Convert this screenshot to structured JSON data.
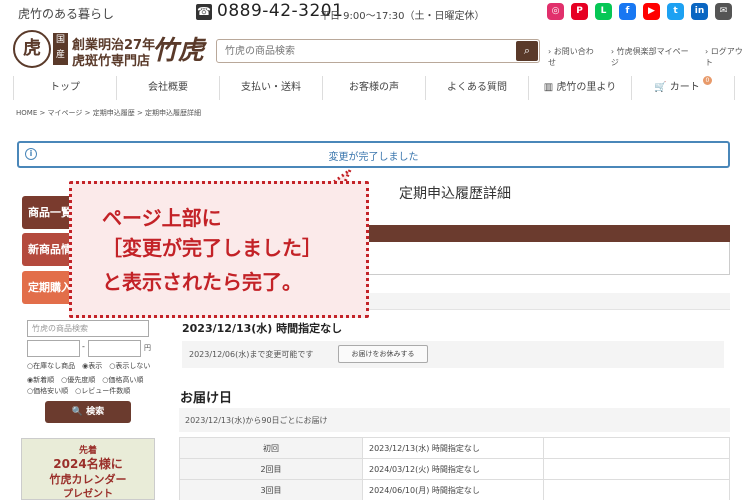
{
  "topbar": {
    "tagline": "虎竹のある暮らし",
    "phone": "0889-42-3201",
    "hours": "平日 9:00～17:30（土・日曜定休）",
    "social": [
      {
        "name": "instagram-icon",
        "color": "#e1306c",
        "glyph": "◎"
      },
      {
        "name": "pinterest-icon",
        "color": "#e60023",
        "glyph": "P"
      },
      {
        "name": "line-icon",
        "color": "#06c755",
        "glyph": "L"
      },
      {
        "name": "facebook-icon",
        "color": "#1877f2",
        "glyph": "f"
      },
      {
        "name": "youtube-icon",
        "color": "#ff0000",
        "glyph": "▶"
      },
      {
        "name": "twitter-icon",
        "color": "#1da1f2",
        "glyph": "t"
      },
      {
        "name": "linkedin-icon",
        "color": "#0a66c2",
        "glyph": "in"
      },
      {
        "name": "email-icon",
        "color": "#555555",
        "glyph": "✉"
      }
    ]
  },
  "header": {
    "logo_mark": "虎",
    "logo_seal": "国産",
    "logo_line1": "創業明治27年",
    "logo_line2": "虎斑竹専門店",
    "logo_brush": "竹虎",
    "search_placeholder": "竹虎の商品検索",
    "links": [
      "› お問い合わせ",
      "› 竹虎倶楽部マイページ",
      "› ログアウト"
    ]
  },
  "nav": {
    "items": [
      "トップ",
      "会社概要",
      "支払い・送料",
      "お客様の声",
      "よくある質問",
      "虎竹の里より",
      "カート"
    ],
    "cart_count": "0"
  },
  "breadcrumb": "HOME > マイページ > 定期申込履歴 > 定期申込履歴詳細",
  "alert": {
    "icon": "i",
    "message": "変更が完了しました"
  },
  "sidebar": {
    "buttons": [
      {
        "label": "商品一覧",
        "color": "#7a3b2e"
      },
      {
        "label": "新商品情報",
        "color": "#b44a3d"
      },
      {
        "label": "定期購入",
        "color": "#e26e4a"
      }
    ],
    "search_placeholder": "竹虎の商品検索",
    "price_unit": "円",
    "radio_row1": "○在庫なし商品　◉表示　○表示しない",
    "radio_row2": "◉新着順　○優先度順　○価格高い順",
    "radio_row3": "○価格安い順　○レビュー件数順",
    "search_button": "🔍 検索",
    "banner": {
      "l1": "先着",
      "l2": "2024名様に",
      "l3": "竹虎カレンダー",
      "l4": "プレゼント"
    }
  },
  "main": {
    "page_title": "定期申込履歴詳細",
    "next_date": "2023/12/13(水) 時間指定なし",
    "deadline": "2023/12/06(水)まで変更可能です",
    "skip_button": "お届けをお休みする",
    "delivery_title": "お届け日",
    "delivery_text": "2023/12/13(水)から90日ごとにお届け",
    "schedule": [
      {
        "label": "初回",
        "value": "2023/12/13(水) 時間指定なし"
      },
      {
        "label": "2回目",
        "value": "2024/03/12(火) 時間指定なし"
      },
      {
        "label": "3回目",
        "value": "2024/06/10(月) 時間指定なし"
      }
    ]
  },
  "callout": {
    "line1": "ページ上部に",
    "line2": "［変更が完了しました］",
    "line3": "と表示されたら完了。",
    "color": "#c32227"
  }
}
